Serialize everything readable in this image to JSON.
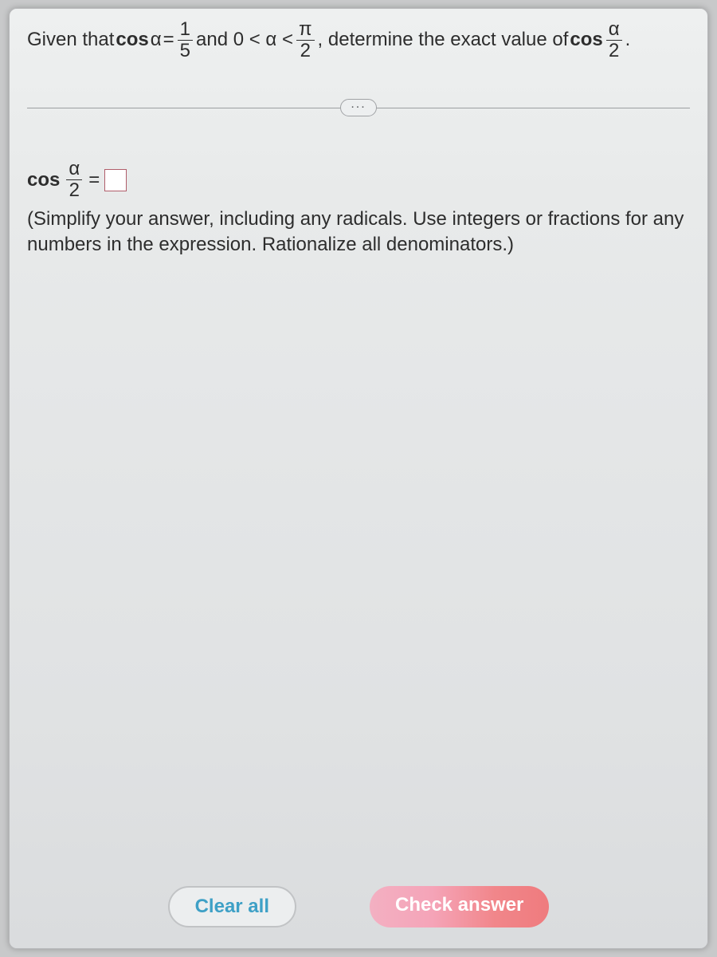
{
  "question": {
    "p1": "Given that ",
    "cos": "cos",
    "alpha": "α",
    "eq": " = ",
    "frac1": {
      "num": "1",
      "den": "5"
    },
    "p2": " and 0 < α < ",
    "frac2": {
      "num": "π",
      "den": "2"
    },
    "p3": ", determine the exact value of ",
    "frac3": {
      "num": "α",
      "den": "2"
    },
    "p4": "."
  },
  "ellipsis_label": "...",
  "answer": {
    "cos": "cos",
    "frac": {
      "num": "α",
      "den": "2"
    },
    "eq": " = "
  },
  "instructions": "(Simplify your answer, including any radicals. Use integers or fractions for any numbers in the expression. Rationalize all denominators.)",
  "buttons": {
    "clear": "Clear all",
    "check": "Check answer"
  }
}
